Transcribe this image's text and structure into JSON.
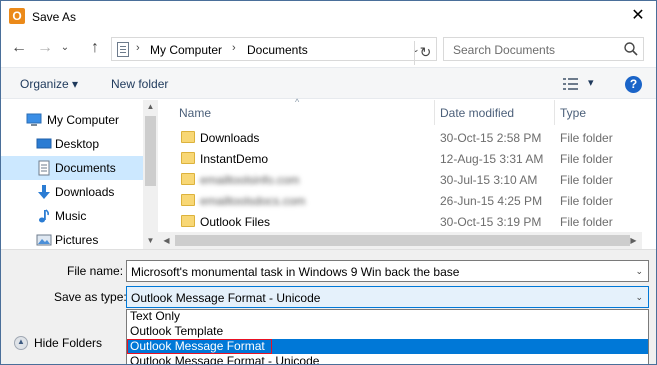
{
  "window": {
    "title": "Save As",
    "app_icon_letter": "O",
    "close_glyph": "✕"
  },
  "nav": {
    "back_glyph": "←",
    "forward_glyph": "→",
    "recent_glyph": "⌄",
    "up_glyph": "↑",
    "breadcrumbs": [
      "My Computer",
      "Documents"
    ],
    "separator": "›",
    "refresh_glyph": "↻",
    "dropdown_glyph": "⌄",
    "search_placeholder": "Search Documents"
  },
  "toolbar": {
    "organize_label": "Organize ▾",
    "new_folder_label": "New folder",
    "view_dropdown_glyph": "▾",
    "help_glyph": "?"
  },
  "navpane": {
    "items": [
      {
        "label": "My Computer",
        "icon": "computer-icon",
        "selected": false
      },
      {
        "label": "Desktop",
        "icon": "desktop-icon",
        "selected": false
      },
      {
        "label": "Documents",
        "icon": "documents-icon",
        "selected": true
      },
      {
        "label": "Downloads",
        "icon": "downloads-icon",
        "selected": false
      },
      {
        "label": "Music",
        "icon": "music-icon",
        "selected": false
      },
      {
        "label": "Pictures",
        "icon": "pictures-icon",
        "selected": false
      }
    ],
    "scroll_up": "▲",
    "scroll_down": "▼"
  },
  "filelist": {
    "columns": {
      "name": "Name",
      "date": "Date modified",
      "type": "Type"
    },
    "sort_indicator": "^",
    "rows": [
      {
        "name": "Downloads",
        "date": "30-Oct-15 2:58 PM",
        "type": "File folder",
        "blurred": false
      },
      {
        "name": "InstantDemo",
        "date": "12-Aug-15 3:31 AM",
        "type": "File folder",
        "blurred": false
      },
      {
        "name": "emailtoolsinfo.com",
        "date": "30-Jul-15 3:10 AM",
        "type": "File folder",
        "blurred": true
      },
      {
        "name": "emailtoolsdocs.com",
        "date": "26-Jun-15 4:25 PM",
        "type": "File folder",
        "blurred": true
      },
      {
        "name": "Outlook Files",
        "date": "30-Oct-15 3:19 PM",
        "type": "File folder",
        "blurred": false
      }
    ],
    "scroll_left": "◀",
    "scroll_right": "▶"
  },
  "form": {
    "filename_label": "File name:",
    "filename_value": "Microsoft's monumental task in Windows 9 Win back the base",
    "savetype_label": "Save as type:",
    "savetype_value": "Outlook Message Format - Unicode",
    "dropdown_glyph": "⌄",
    "options": [
      {
        "label": "Text Only",
        "selected": false
      },
      {
        "label": "Outlook Template",
        "selected": false
      },
      {
        "label": "Outlook Message Format",
        "selected": true
      },
      {
        "label": "Outlook Message Format - Unicode",
        "selected": false
      }
    ],
    "hide_folders_label": "Hide Folders",
    "hide_folders_glyph": "▲"
  }
}
